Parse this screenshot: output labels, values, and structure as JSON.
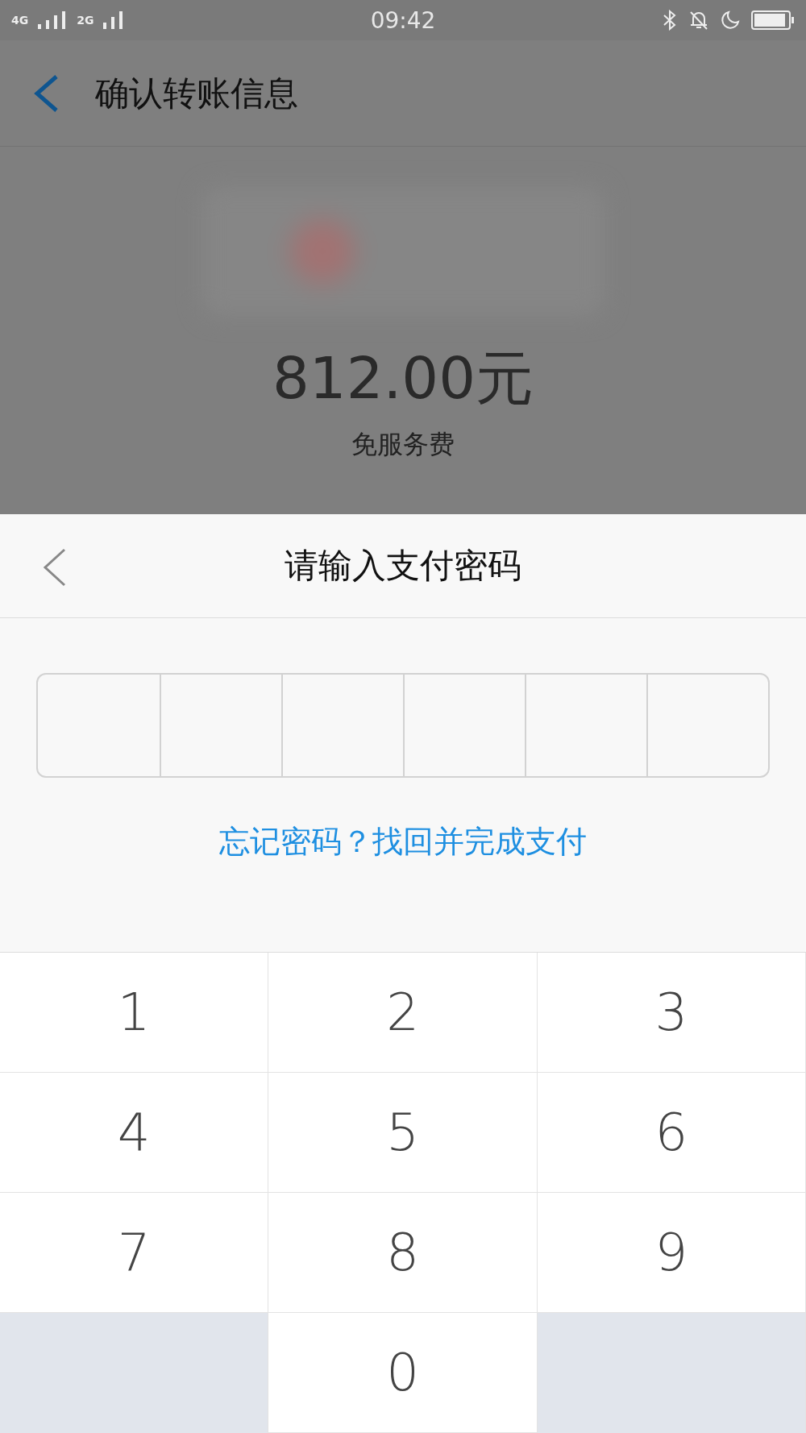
{
  "status_bar": {
    "network_left": "4G",
    "network_right": "2G",
    "time": "09:42"
  },
  "header": {
    "title": "确认转账信息"
  },
  "transfer": {
    "amount": "812.00元",
    "fee_note": "免服务费"
  },
  "password_sheet": {
    "title": "请输入支付密码",
    "cells": [
      {
        "filled": false
      },
      {
        "filled": false
      },
      {
        "filled": false
      },
      {
        "filled": false
      },
      {
        "filled": false
      },
      {
        "filled": false
      }
    ],
    "forgot_link": "忘记密码？找回并完成支付"
  },
  "keypad": [
    {
      "kind": "digit",
      "label": "1"
    },
    {
      "kind": "digit",
      "label": "2"
    },
    {
      "kind": "digit",
      "label": "3"
    },
    {
      "kind": "digit",
      "label": "4"
    },
    {
      "kind": "digit",
      "label": "5"
    },
    {
      "kind": "digit",
      "label": "6"
    },
    {
      "kind": "digit",
      "label": "7"
    },
    {
      "kind": "digit",
      "label": "8"
    },
    {
      "kind": "digit",
      "label": "9"
    },
    {
      "kind": "blank"
    },
    {
      "kind": "digit",
      "label": "0"
    },
    {
      "kind": "blank"
    }
  ]
}
